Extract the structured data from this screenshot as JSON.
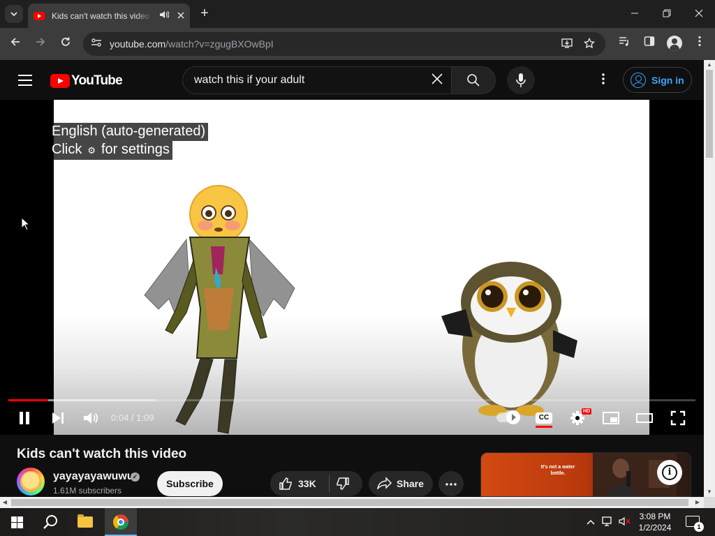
{
  "browser": {
    "tab_title": "Kids can't watch this video - YouTube",
    "url_host": "youtube.com",
    "url_path": "/watch?v=zgugBXOwBpI",
    "new_tab_label": "+"
  },
  "youtube": {
    "logo_text": "YouTube",
    "search_query": "watch this if your adult",
    "sign_in_label": "Sign in",
    "player": {
      "caption_line1": "English (auto-generated)",
      "caption_line2_a": "Click",
      "caption_line2_b": "for settings",
      "time_current": "0:04",
      "time_total": "1:09",
      "time_display": "0:04 / 1:09",
      "progress_played": 0.058,
      "progress_loaded": 0.215,
      "cc_label": "CC",
      "hd_badge": "HD",
      "is_playing": true
    },
    "video": {
      "title": "Kids can't watch this video",
      "channel_name": "yayayayawuwu",
      "subscribers": "1.61M subscribers",
      "subscribe_label": "Subscribe",
      "like_count": "33K",
      "share_label": "Share"
    },
    "ad": {
      "text": "It's not a water bottle."
    }
  },
  "taskbar": {
    "time": "3:08 PM",
    "date": "1/2/2024",
    "notification_count": "1"
  },
  "colors": {
    "brand_red": "#ff0000",
    "link_blue": "#3ea6ff",
    "page_bg": "#0f0f0f"
  }
}
